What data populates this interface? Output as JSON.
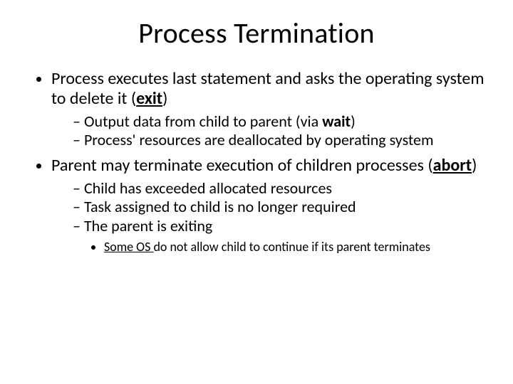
{
  "title": "Process Termination",
  "bullets": {
    "b1": {
      "pre": "Process executes last statement and asks the operating system to delete it (",
      "kw": "exit",
      "post": ")",
      "sub": {
        "s1_pre": "Output data from child to parent (via ",
        "s1_kw": "wait",
        "s1_post": ")",
        "s2": "Process' resources are deallocated by operating system"
      }
    },
    "b2": {
      "pre": "Parent may terminate execution of children processes (",
      "kw": "abort",
      "post": ")",
      "sub": {
        "s1": "Child has exceeded allocated resources",
        "s2": "Task assigned to child is no longer required",
        "s3": "The parent is exiting",
        "ss1_kw": "Some OS ",
        "ss1_post": "do not allow child to continue if its parent terminates"
      }
    }
  }
}
